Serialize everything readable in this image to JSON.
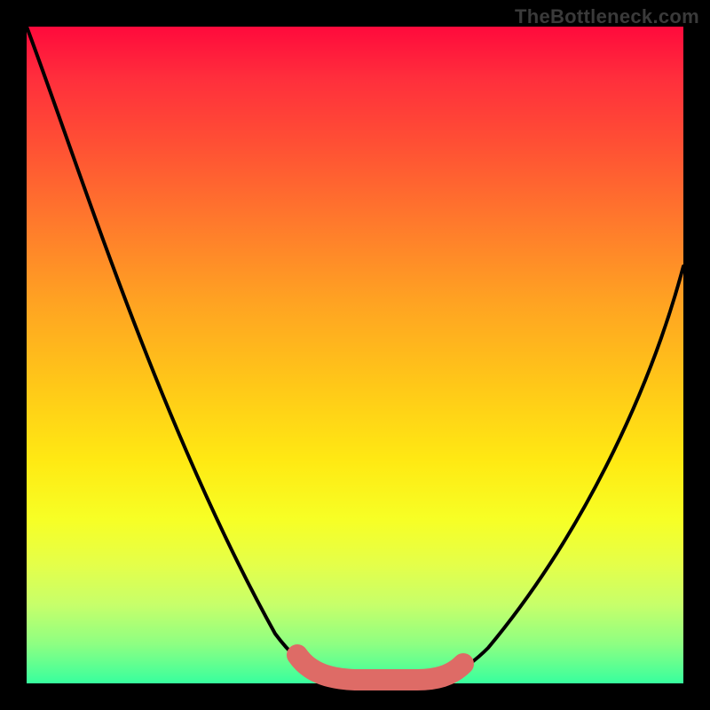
{
  "watermark": "TheBottleneck.com",
  "colors": {
    "frame": "#000000",
    "curve": "#000000",
    "optimal_band": "#de6b66",
    "gradient_top": "#ff0a3c",
    "gradient_bottom": "#37ff9e"
  },
  "chart_data": {
    "type": "line",
    "title": "",
    "xlabel": "",
    "ylabel": "",
    "xlim": [
      0,
      100
    ],
    "ylim": [
      0,
      100
    ],
    "grid": false,
    "background": "vertical-gradient-red-to-green",
    "series": [
      {
        "name": "bottleneck-curve",
        "x": [
          0,
          10,
          20,
          30,
          38,
          44,
          50,
          55,
          60,
          66,
          75,
          85,
          95,
          100
        ],
        "y": [
          100,
          82,
          58,
          34,
          14,
          4,
          1,
          0,
          0,
          2,
          12,
          32,
          54,
          64
        ]
      },
      {
        "name": "optimal-range-highlight",
        "x": [
          41,
          45,
          50,
          55,
          60,
          66
        ],
        "y": [
          4,
          1,
          0,
          0,
          0,
          3
        ]
      }
    ],
    "annotations": [
      {
        "text": "TheBottleneck.com",
        "position": "top-right"
      }
    ]
  }
}
